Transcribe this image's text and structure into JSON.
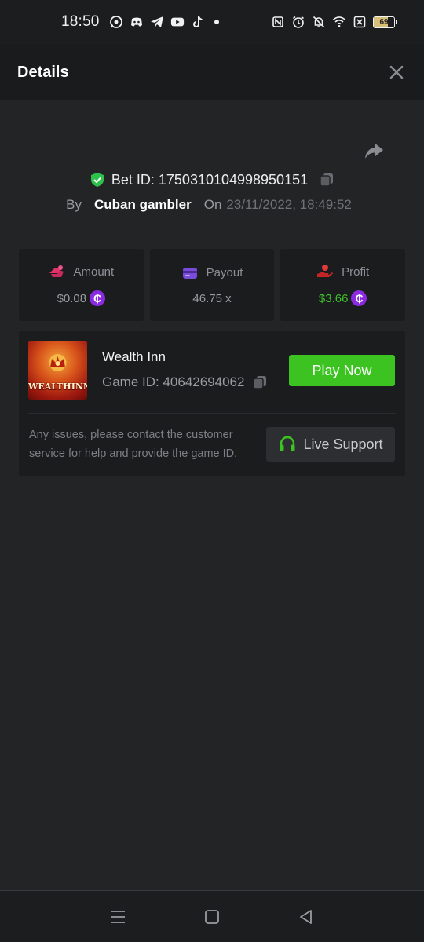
{
  "status_bar": {
    "time": "18:50",
    "apps": [
      "whatsapp-icon",
      "discord-icon",
      "telegram-icon",
      "youtube-icon",
      "tiktok-icon"
    ],
    "battery": "69",
    "battery_level": 0.69
  },
  "header": {
    "title": "Details"
  },
  "bet": {
    "id_text": "Bet ID: 1750310104998950151",
    "by_label": "By",
    "user": "Cuban gambler",
    "on_label": "On",
    "date": "23/11/2022, 18:49:52"
  },
  "stats": [
    {
      "label": "Amount",
      "value": "$0.08",
      "icon": "amount-icon",
      "coin": true
    },
    {
      "label": "Payout",
      "value": "46.75 x",
      "icon": "payout-icon",
      "coin": false
    },
    {
      "label": "Profit",
      "value": "$3.66",
      "icon": "profit-icon",
      "coin": true
    }
  ],
  "game": {
    "name": "Wealth Inn",
    "id_text": "Game ID: 40642694062",
    "thumb_text": "WEALTHINN",
    "play_label": "Play Now",
    "help_text": "Any issues, please contact the customer service for help and provide the game ID.",
    "support_label": "Live Support"
  },
  "colors": {
    "accent_green": "#3cc321",
    "profit_green": "#3fc22a",
    "coin_purple": "#8a2be2",
    "shield_green": "#2ec24a"
  }
}
